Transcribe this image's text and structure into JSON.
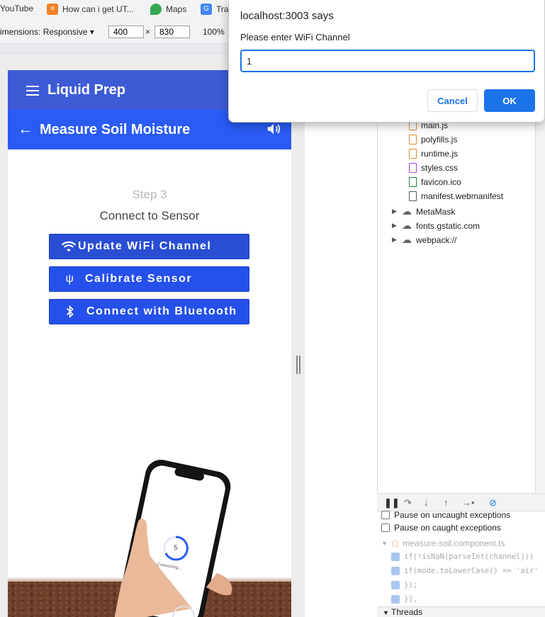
{
  "bookmarks": [
    {
      "label": "YouTube",
      "icon": "youtube-icon"
    },
    {
      "label": "How can i get UT...",
      "icon": "stackoverflow-icon"
    },
    {
      "label": "Maps",
      "icon": "maps-pin-icon"
    },
    {
      "label": "Tra",
      "icon": "translate-icon"
    }
  ],
  "device_toolbar": {
    "dimensions_label": "imensions: Responsive ▾",
    "width": "400",
    "times": "×",
    "height": "830",
    "zoom": "100%"
  },
  "app": {
    "title": "Liquid Prep",
    "page_title": "Measure Soil Moisture",
    "step": "Step 3",
    "step_subtitle": "Connect to Sensor",
    "buttons": {
      "wifi": "Update WiFi Channel",
      "calibrate": "Calibrate Sensor",
      "bluetooth": "Connect with Bluetooth"
    },
    "illustration": {
      "countdown": "5",
      "status": "Connecting..."
    },
    "colors": {
      "toolbar": "#3e5bd6",
      "subbar": "#2a5cf5",
      "button": "#2650ec"
    }
  },
  "sources_tree": {
    "files": [
      {
        "name": "main.js",
        "type": "js"
      },
      {
        "name": "polyfills.js",
        "type": "js"
      },
      {
        "name": "runtime.js",
        "type": "js"
      },
      {
        "name": "styles.css",
        "type": "css"
      },
      {
        "name": "favicon.ico",
        "type": "image"
      },
      {
        "name": "manifest.webmanifest",
        "type": "file"
      }
    ],
    "groups": [
      "MetaMask",
      "fonts.gstatic.com",
      "webpack://"
    ]
  },
  "debugger": {
    "pause_uncaught": "Pause on uncaught exceptions",
    "pause_caught": "Pause on caught exceptions",
    "breakpoint_file": "measure-soil.component.ts",
    "breakpoints": [
      "if(!isNaN(parseInt(channel)))",
      "if(mode.toLowerCase() == 'air'",
      "});",
      "}],"
    ],
    "threads": "Threads"
  },
  "dialog": {
    "origin": "localhost:3003 says",
    "message": "Please enter WiFi Channel",
    "value": "1",
    "cancel": "Cancel",
    "ok": "OK"
  }
}
